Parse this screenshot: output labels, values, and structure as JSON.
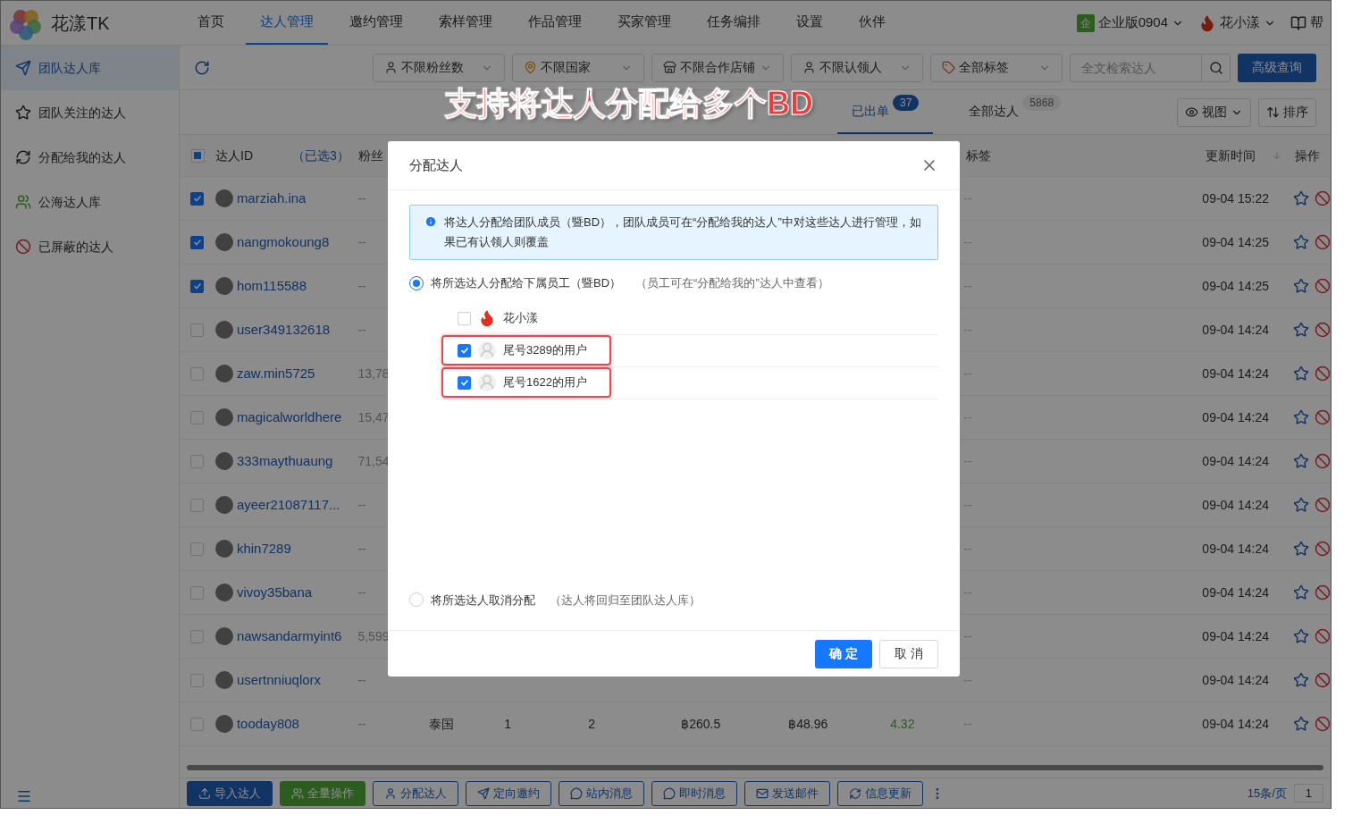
{
  "app": {
    "logo": "花漾TK"
  },
  "nav": [
    {
      "label": "首页",
      "selected": false
    },
    {
      "label": "达人管理",
      "selected": true
    },
    {
      "label": "邀约管理",
      "selected": false
    },
    {
      "label": "索样管理",
      "selected": false
    },
    {
      "label": "作品管理",
      "selected": false
    },
    {
      "label": "买家管理",
      "selected": false
    },
    {
      "label": "任务编排",
      "selected": false
    },
    {
      "label": "设置",
      "selected": false
    },
    {
      "label": "伙伴",
      "selected": false
    }
  ],
  "account": {
    "badge": "企",
    "edition": "企业版0904",
    "user": "花小漾",
    "help": "帮"
  },
  "sidebar": [
    {
      "label": "团队达人库",
      "selected": true
    },
    {
      "label": "团队关注的达人",
      "selected": false
    },
    {
      "label": "分配给我的达人",
      "selected": false
    },
    {
      "label": "公海达人库",
      "selected": false
    },
    {
      "label": "已屏蔽的达人",
      "selected": false
    }
  ],
  "filters": [
    {
      "label": "不限粉丝数",
      "kind": "fans"
    },
    {
      "label": "不限国家",
      "kind": "country"
    },
    {
      "label": "不限合作店铺",
      "kind": "shop"
    },
    {
      "label": "不限认领人",
      "kind": "owner"
    },
    {
      "label": "全部标签",
      "kind": "tag"
    }
  ],
  "search": {
    "placeholder": "全文检索达人"
  },
  "advanced_button": "高级查询",
  "annotation": "支持将达人分配给多个BD",
  "tabs": [
    {
      "label": "已出单",
      "count": "37",
      "selected": true
    },
    {
      "label": "全部达人",
      "count": "5868",
      "selected": false
    }
  ],
  "view_button": "视图",
  "sort_button": "排序",
  "table": {
    "header": {
      "indeterminate": true,
      "id": "达人ID",
      "selected_count": "（已选3）",
      "fans": "粉丝",
      "tags": "标签",
      "updated": "更新时间",
      "actions": "操作"
    },
    "rows": [
      {
        "id": "marziah.ina",
        "checked": true,
        "fans": "--",
        "tags": "--",
        "updated": "09-04 15:22"
      },
      {
        "id": "nangmokoung8",
        "checked": true,
        "fans": "--",
        "tags": "--",
        "updated": "09-04 14:25"
      },
      {
        "id": "hom115588",
        "checked": true,
        "fans": "--",
        "tags": "--",
        "updated": "09-04 14:25"
      },
      {
        "id": "user349132618",
        "checked": false,
        "fans": "--",
        "tags": "--",
        "updated": "09-04 14:24"
      },
      {
        "id": "zaw.min5725",
        "checked": false,
        "fans": "13,78",
        "tags": "--",
        "updated": "09-04 14:24"
      },
      {
        "id": "magicalworldhere",
        "checked": false,
        "fans": "15,47",
        "tags": "--",
        "updated": "09-04 14:24"
      },
      {
        "id": "333maythuaung",
        "checked": false,
        "fans": "71,54",
        "tags": "--",
        "updated": "09-04 14:24"
      },
      {
        "id": "ayeer21087117...",
        "checked": false,
        "fans": "--",
        "tags": "--",
        "updated": "09-04 14:24"
      },
      {
        "id": "khin7289",
        "checked": false,
        "fans": "--",
        "tags": "--",
        "updated": "09-04 14:24"
      },
      {
        "id": "vivoy35bana",
        "checked": false,
        "fans": "--",
        "tags": "--",
        "updated": "09-04 14:24"
      },
      {
        "id": "nawsandarmyint6",
        "checked": false,
        "fans": "5,599",
        "tags": "--",
        "updated": "09-04 14:24"
      },
      {
        "id": "usertnniuqlorx",
        "checked": false,
        "fans": "--",
        "tags": "--",
        "updated": "09-04 14:24"
      },
      {
        "id": "tooday808",
        "checked": false,
        "fans": "--",
        "country": "泰国",
        "column_4": "1",
        "column_5": "2",
        "column_6": "฿260.5",
        "column_7": "฿48.96",
        "column_8": "4.32",
        "tags": "--",
        "updated": "09-04 14:24"
      }
    ]
  },
  "dialog": {
    "title": "分配达人",
    "info": "将达人分配给团队成员（暨BD），团队成员可在“分配给我的达人”中对这些达人进行管理，如果已有认领人则覆盖",
    "options": [
      {
        "label": "将所选达人分配给下属员工（暨BD）",
        "hint": "（员工可在“分配给我的”达人中查看）",
        "selected": true
      },
      {
        "label": "将所选达人取消分配",
        "hint": "（达人将回归至团队达人库）",
        "selected": false
      }
    ],
    "members": [
      {
        "name": "花小漾",
        "kind": "owner",
        "checked": false,
        "highlighted": false
      },
      {
        "name": "尾号3289的用户",
        "kind": "member",
        "checked": true,
        "highlighted": true
      },
      {
        "name": "尾号1622的用户",
        "kind": "member",
        "checked": true,
        "highlighted": true
      }
    ],
    "confirm": "确 定",
    "cancel": "取 消"
  },
  "footer": {
    "buttons": [
      "导入达人",
      "全量操作",
      "分配达人",
      "定向邀约",
      "站内消息",
      "即时消息",
      "发送邮件",
      "信息更新"
    ],
    "page_size": "15条/页",
    "page": "1"
  }
}
